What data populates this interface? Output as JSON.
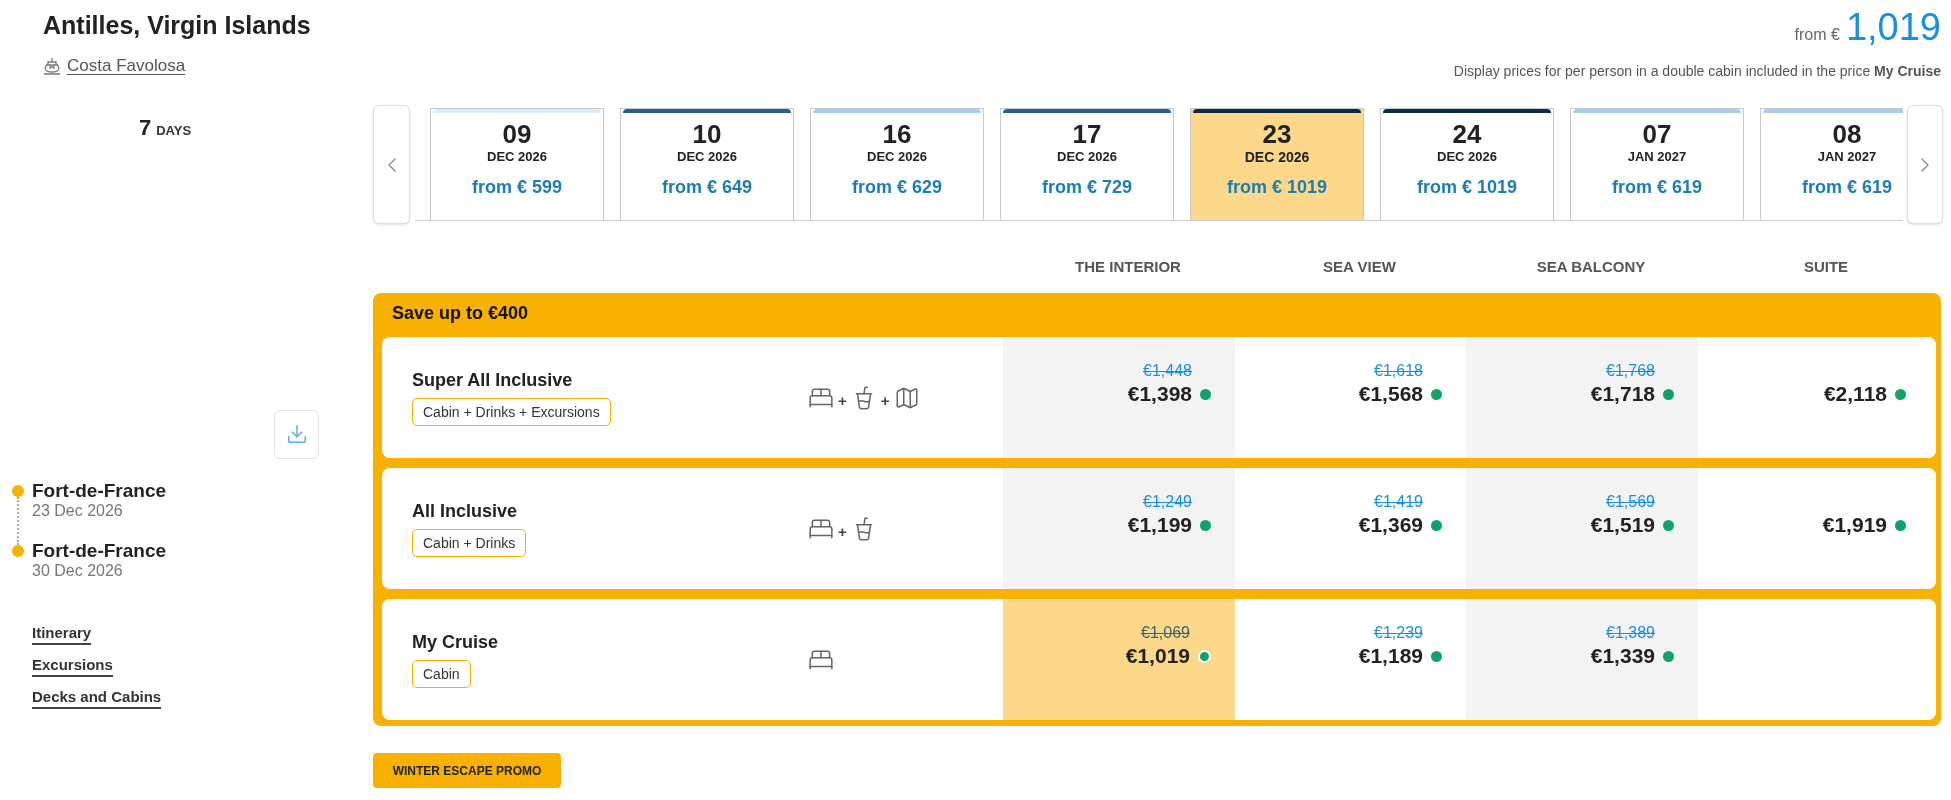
{
  "header": {
    "title": "Antilles, Virgin Islands",
    "ship": "Costa Favolosa",
    "price_prefix": "from €",
    "price": "1,019",
    "note": "Display prices for per person in a double cabin included in the price **My Cruise**"
  },
  "duration": {
    "number": "7",
    "unit": "DAYS"
  },
  "dates": [
    {
      "day": "09",
      "month": "DEC 2026",
      "price": "from € 599",
      "color": "#dcedf9",
      "selected": false
    },
    {
      "day": "10",
      "month": "DEC 2026",
      "price": "from € 649",
      "color": "#245f95",
      "selected": false
    },
    {
      "day": "16",
      "month": "DEC 2026",
      "price": "from € 629",
      "color": "#a9cdee",
      "selected": false
    },
    {
      "day": "17",
      "month": "DEC 2026",
      "price": "from € 729",
      "color": "#245f95",
      "selected": false
    },
    {
      "day": "23",
      "month": "DEC 2026",
      "price": "from € 1019",
      "color": "#0d2b45",
      "selected": true
    },
    {
      "day": "24",
      "month": "DEC 2026",
      "price": "from € 1019",
      "color": "#0d2b45",
      "selected": false
    },
    {
      "day": "07",
      "month": "JAN 2027",
      "price": "from € 619",
      "color": "#a9cdee",
      "selected": false
    },
    {
      "day": "08",
      "month": "JAN 2027",
      "price": "from € 619",
      "color": "#a9cdee",
      "selected": false
    }
  ],
  "cabin_columns": [
    "THE INTERIOR",
    "SEA VIEW",
    "SEA BALCONY",
    "SUITE"
  ],
  "offer": {
    "title": "Save up to €400",
    "packages": [
      {
        "name": "Super All Inclusive",
        "tag": "Cabin + Drinks + Excursions",
        "inclusions": [
          {
            "kind": "bed"
          },
          {
            "kind": "drink",
            "joiner": "+"
          },
          {
            "kind": "map",
            "joiner": "+"
          }
        ],
        "prices": [
          {
            "old": "€1,448",
            "price": "€1,398",
            "selected": false
          },
          {
            "old": "€1,618",
            "price": "€1,568",
            "selected": false
          },
          {
            "old": "€1,768",
            "price": "€1,718",
            "selected": false
          },
          {
            "price": "€2,118",
            "selected": false
          }
        ]
      },
      {
        "name": "All Inclusive",
        "tag": "Cabin + Drinks",
        "inclusions": [
          {
            "kind": "bed"
          },
          {
            "kind": "drink",
            "joiner": "+"
          }
        ],
        "prices": [
          {
            "old": "€1,249",
            "price": "€1,199",
            "selected": false
          },
          {
            "old": "€1,419",
            "price": "€1,369",
            "selected": false
          },
          {
            "old": "€1,569",
            "price": "€1,519",
            "selected": false
          },
          {
            "price": "€1,919",
            "selected": false
          }
        ]
      },
      {
        "name": "My Cruise",
        "tag": "Cabin",
        "inclusions": [
          {
            "kind": "bed"
          }
        ],
        "prices": [
          {
            "old": "€1,069",
            "price": "€1,019",
            "selected": true
          },
          {
            "old": "€1,239",
            "price": "€1,189",
            "selected": false
          },
          {
            "old": "€1,389",
            "price": "€1,339",
            "selected": false
          }
        ]
      }
    ]
  },
  "itinerary": [
    {
      "port": "Fort-de-France",
      "date": "23 Dec 2026"
    },
    {
      "port": "Fort-de-France",
      "date": "30 Dec 2026"
    }
  ],
  "links": [
    "Itinerary",
    "Excursions",
    "Decks and Cabins"
  ],
  "promo": "WINTER ESCAPE PROMO"
}
